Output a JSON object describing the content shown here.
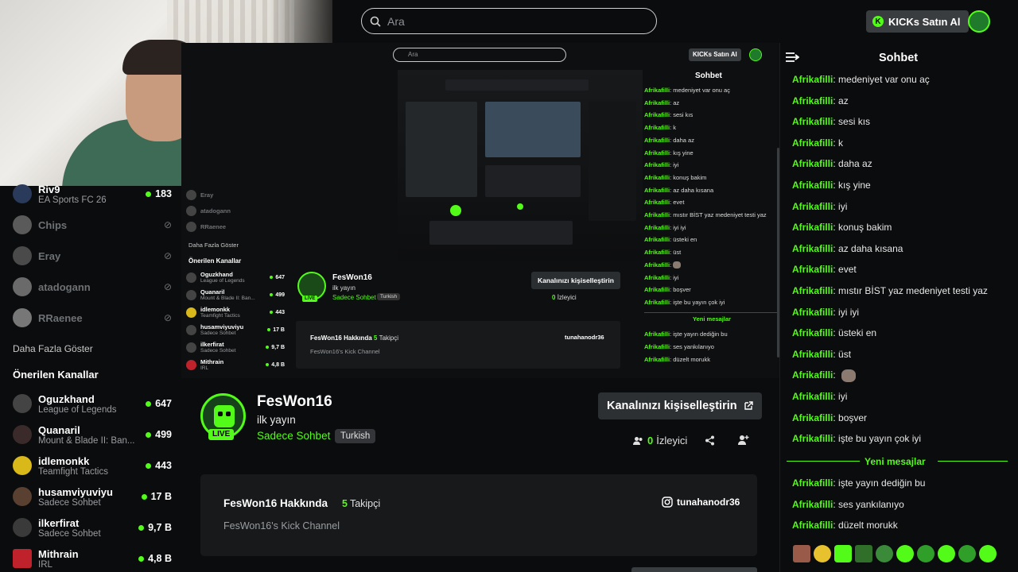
{
  "topbar": {
    "search_placeholder": "Ara",
    "kicks_button": "KICKs Satın Al"
  },
  "sidebar": {
    "channels": [
      {
        "name": "Riv9",
        "sub": "EA Sports FC 26",
        "viewers": "183",
        "online": true
      },
      {
        "name": "Chips",
        "online": false
      },
      {
        "name": "Eray",
        "online": false
      },
      {
        "name": "atadogann",
        "online": false
      },
      {
        "name": "RRaenee",
        "online": false
      }
    ],
    "show_more": "Daha Fazla Göster",
    "recommended_title": "Önerilen Kanallar",
    "recommended": [
      {
        "name": "Oguzkhand",
        "sub": "League of Legends",
        "viewers": "647"
      },
      {
        "name": "Quanaril",
        "sub": "Mount & Blade II: Ban...",
        "viewers": "499"
      },
      {
        "name": "idlemonkk",
        "sub": "Teamfight Tactics",
        "viewers": "443"
      },
      {
        "name": "husamviyuviyu",
        "sub": "Sadece Sohbet",
        "viewers": "17 B"
      },
      {
        "name": "ilkerfirat",
        "sub": "Sadece Sohbet",
        "viewers": "9,7 B"
      },
      {
        "name": "Mithrain",
        "sub": "IRL",
        "viewers": "4,8 B"
      }
    ]
  },
  "nested": {
    "search_placeholder": "Ara",
    "kicks_button": "KICKs Satın Al",
    "chat_title": "Sohbet",
    "left_channels": [
      {
        "name": "Eray",
        "off": true
      },
      {
        "name": "atadogann",
        "off": true
      },
      {
        "name": "RRaenee",
        "off": true
      }
    ],
    "show_more": "Daha Fazla Göster",
    "recommended_title": "Önerilen Kanallar",
    "recommended": [
      {
        "name": "Oguzkhand",
        "sub": "League of Legends",
        "viewers": "647"
      },
      {
        "name": "Quanaril",
        "sub": "Mount & Blade II: Ban...",
        "viewers": "499"
      },
      {
        "name": "idlemonkk",
        "sub": "Teamfight Tactics",
        "viewers": "443"
      },
      {
        "name": "husamviyuviyu",
        "sub": "Sadece Sohbet",
        "viewers": "17 B"
      },
      {
        "name": "ilkerfirat",
        "sub": "Sadece Sohbet",
        "viewers": "9,7 B"
      },
      {
        "name": "Mithrain",
        "sub": "IRL",
        "viewers": "4,8 B"
      }
    ],
    "channel_name": "FesWon16",
    "stream_title": "ilk yayın",
    "category": "Sadece Sohbet",
    "language": "Turkish",
    "live": "LIVE",
    "customize": "Kanalınızı kişiselleştirin",
    "viewers": "0",
    "viewers_label": "İzleyici",
    "about_title": "FesWon16 Hakkında",
    "followers": "5",
    "followers_label": "Takipçi",
    "about_desc": "FesWon16's Kick Channel",
    "instagram": "tunahanodr36",
    "chat_user": "Afrikafilli",
    "chat_messages": [
      "medeniyet var onu aç",
      "az",
      "sesi kıs",
      "k",
      "daha az",
      "kış yine",
      "iyi",
      "konuş bakim",
      "az daha kısana",
      "evet",
      "mıstır BİST yaz medeniyet testi yaz",
      "iyi iyi",
      "üsteki en",
      "üst",
      "",
      "iyi",
      "boşver",
      "işte bu yayın çok iyi"
    ],
    "new_messages": "Yeni mesajlar",
    "chat_messages2": [
      "işte yayın dediğin bu",
      "ses yankılanıyo",
      "düzelt morukk"
    ]
  },
  "channel": {
    "name": "FesWon16",
    "stream_title": "ilk yayın",
    "category": "Sadece Sohbet",
    "language": "Turkish",
    "live": "LIVE",
    "customize": "Kanalınızı kişiselleştirin",
    "viewers": "0",
    "viewers_label": "İzleyici"
  },
  "about": {
    "title": "FesWon16 Hakkında",
    "followers": "5",
    "followers_label": "Takipçi",
    "description": "FesWon16's Kick Channel",
    "instagram": "tunahanodr36"
  },
  "chat": {
    "title": "Sohbet",
    "user": "Afrikafilli",
    "messages": [
      "medeniyet var onu aç",
      "az",
      "sesi kıs",
      "k",
      "daha az",
      "kış yine",
      "iyi",
      "konuş bakim",
      "az daha kısana",
      "evet",
      "mıstır BİST yaz medeniyet testi yaz",
      "iyi iyi",
      "üsteki en",
      "üst",
      "",
      "iyi",
      "boşver",
      "işte bu yayın çok iyi"
    ],
    "new_messages": "Yeni mesajlar",
    "new_user": "Afrikafilli",
    "new_messages_list": [
      "işte yayın dediğin bu",
      "ses yankılanıyo",
      "düzelt morukk"
    ]
  },
  "colors": {
    "accent": "#53fc18",
    "background": "#0b0c0d",
    "card": "#17191b"
  },
  "icons": [
    "search-icon",
    "kick-coin-icon",
    "user-avatar-icon",
    "chat-collapse-icon",
    "live-icon",
    "external-link-icon",
    "viewers-icon",
    "share-icon",
    "follow-icon",
    "instagram-icon",
    "offline-icon"
  ]
}
